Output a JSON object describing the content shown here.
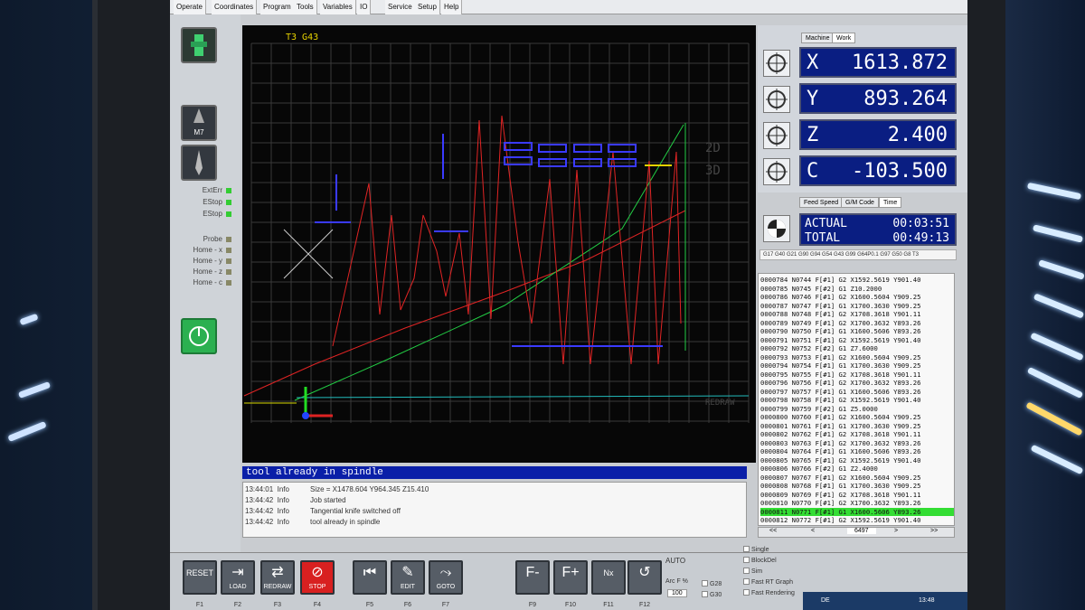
{
  "menu": {
    "items": [
      "Operate",
      "Coordinates",
      "Program",
      "Tools",
      "Variables",
      "IO",
      "Service",
      "Setup",
      "Help"
    ]
  },
  "viewport": {
    "tool_label": "T3 G43",
    "side_labels": [
      "2D",
      "3D",
      "REDRAW"
    ]
  },
  "leds": {
    "group1": [
      "ExtErr",
      "EStop",
      "EStop"
    ],
    "group2": [
      "Probe",
      "Home - x",
      "Home - y",
      "Home - z",
      "Home - c"
    ]
  },
  "left_buttons": {
    "m7_label": "M7"
  },
  "status": {
    "message": "tool already in spindle"
  },
  "log": {
    "rows": [
      {
        "time": "13:44:01",
        "level": "Info",
        "msg": "Size = X1478.604 Y964.345 Z15.410"
      },
      {
        "time": "13:44:42",
        "level": "Info",
        "msg": "Job started"
      },
      {
        "time": "13:44:42",
        "level": "Info",
        "msg": "Tangential knife switched off"
      },
      {
        "time": "13:44:42",
        "level": "Info",
        "msg": "tool already in spindle"
      }
    ]
  },
  "dro": {
    "tabs": [
      "Machine",
      "Work"
    ],
    "axes": [
      {
        "label": "X",
        "value": "1613.872"
      },
      {
        "label": "Y",
        "value": "893.264"
      },
      {
        "label": "Z",
        "value": "2.400"
      },
      {
        "label": "C",
        "value": "-103.500"
      }
    ]
  },
  "info_tabs": [
    "Feed Speed",
    "G/M Code",
    "Time"
  ],
  "time": {
    "actual_label": "ACTUAL",
    "actual": "00:03:51",
    "total_label": "TOTAL",
    "total": "00:49:13"
  },
  "modal_codes": "G17 G40 G21 G90 G94 G54 G43 G99 G64P0.1 G97 G50 G8 T3",
  "gcode": {
    "lines": [
      "0000784 N0744 F[#1] G2 X1592.5619 Y901.40",
      "0000785 N0745 F[#2] G1 Z10.2000",
      "0000786 N0746 F[#1] G2 X1600.5604 Y909.25",
      "0000787 N0747 F[#1] G1 X1700.3630 Y909.25",
      "0000788 N0748 F[#1] G2 X1708.3618 Y901.11",
      "0000789 N0749 F[#1] G2 X1700.3632 Y893.26",
      "0000790 N0750 F[#1] G1 X1600.5606 Y893.26",
      "0000791 N0751 F[#1] G2 X1592.5619 Y901.40",
      "0000792 N0752 F[#2] G1 Z7.6000",
      "0000793 N0753 F[#1] G2 X1600.5604 Y909.25",
      "0000794 N0754 F[#1] G1 X1700.3630 Y909.25",
      "0000795 N0755 F[#1] G2 X1708.3618 Y901.11",
      "0000796 N0756 F[#1] G2 X1700.3632 Y893.26",
      "0000797 N0757 F[#1] G1 X1600.5606 Y893.26",
      "0000798 N0758 F[#1] G2 X1592.5619 Y901.40",
      "0000799 N0759 F[#2] G1 Z5.0000",
      "0000800 N0760 F[#1] G2 X1600.5604 Y909.25",
      "0000801 N0761 F[#1] G1 X1700.3630 Y909.25",
      "0000802 N0762 F[#1] G2 X1708.3618 Y901.11",
      "0000803 N0763 F[#1] G2 X1700.3632 Y893.26",
      "0000804 N0764 F[#1] G1 X1600.5606 Y893.26",
      "0000805 N0765 F[#1] G2 X1592.5619 Y901.40",
      "0000806 N0766 F[#2] G1 Z2.4000",
      "0000807 N0767 F[#1] G2 X1600.5604 Y909.25",
      "0000808 N0768 F[#1] G1 X1700.3630 Y909.25",
      "0000809 N0769 F[#1] G2 X1708.3618 Y901.11",
      "0000810 N0770 F[#1] G2 X1700.3632 Y893.26",
      "0000811 N0771 F[#1] G1 X1600.5606 Y893.26",
      "0000812 N0772 F[#1] G2 X1592.5619 Y901.40"
    ],
    "active_index": 27,
    "nav": [
      "<<",
      "<",
      "6497",
      ">",
      ">>"
    ]
  },
  "toolbar": {
    "buttons": [
      {
        "label": "RESET",
        "fkey": "F1"
      },
      {
        "label": "LOAD",
        "fkey": "F2"
      },
      {
        "label": "REDRAW",
        "fkey": "F3"
      },
      {
        "label": "STOP",
        "fkey": "F4"
      },
      {
        "label": "",
        "fkey": "F5"
      },
      {
        "label": "EDIT",
        "fkey": "F6"
      },
      {
        "label": "GOTO",
        "fkey": "F7"
      },
      {
        "label": "",
        "fkey": "F9"
      },
      {
        "label": "",
        "fkey": "F10"
      },
      {
        "label": "",
        "fkey": "F11"
      },
      {
        "label": "",
        "fkey": "F12"
      }
    ],
    "mode": "AUTO",
    "arc_label": "Arc F %",
    "arc_value": "100",
    "g28": "G28",
    "g30": "G30",
    "options": [
      "Single",
      "BlockDel",
      "Sim",
      "Fast RT Graph",
      "Fast Rendering"
    ]
  },
  "taskbar": {
    "lang": "DE",
    "time": "13:48"
  },
  "colors": {
    "dro_bg": "#0a1e82",
    "status_bg": "#0a1fa8",
    "path_red": "#e02424",
    "path_blue": "#3a3aff",
    "path_green": "#22cc44",
    "highlight": "#33dd33"
  }
}
